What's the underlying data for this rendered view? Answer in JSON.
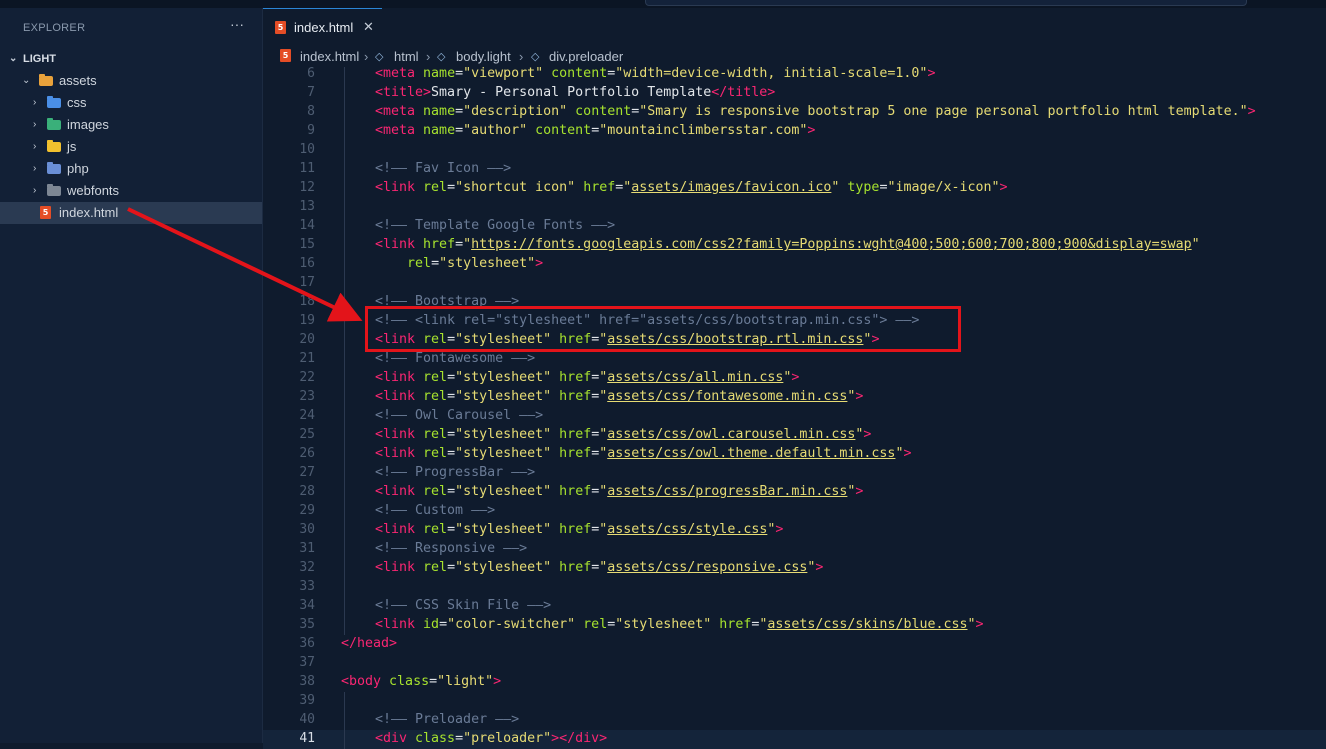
{
  "explorer": {
    "title": "EXPLORER",
    "more": "···",
    "root": "LIGHT",
    "items": [
      {
        "label": "assets",
        "kind": "folder-open",
        "icon": "folder-assets-icon"
      },
      {
        "label": "css",
        "kind": "folder",
        "icon": "folder-css-icon"
      },
      {
        "label": "images",
        "kind": "folder",
        "icon": "folder-images-icon"
      },
      {
        "label": "js",
        "kind": "folder",
        "icon": "folder-js-icon"
      },
      {
        "label": "php",
        "kind": "folder",
        "icon": "folder-php-icon"
      },
      {
        "label": "webfonts",
        "kind": "folder",
        "icon": "folder-webfonts-icon"
      },
      {
        "label": "index.html",
        "kind": "file",
        "icon": "html5-icon"
      }
    ]
  },
  "tab": {
    "label": "index.html",
    "close": "✕"
  },
  "breadcrumb": [
    "index.html",
    "html",
    "body.light",
    "div.preloader"
  ],
  "code": {
    "line_numbers": [
      "6",
      "7",
      "8",
      "9",
      "10",
      "11",
      "12",
      "13",
      "14",
      "15",
      "16",
      "17",
      "18",
      "19",
      "20",
      "21",
      "22",
      "23",
      "24",
      "25",
      "26",
      "27",
      "28",
      "29",
      "30",
      "31",
      "32",
      "33",
      "34",
      "35",
      "36",
      "37",
      "38",
      "39",
      "40",
      "41"
    ],
    "current_line": "41",
    "lines": [
      [
        [
          "t",
          "<meta "
        ],
        [
          "a",
          "name"
        ],
        [
          "p",
          "="
        ],
        [
          "s",
          "\"viewport\""
        ],
        [
          "a",
          " content"
        ],
        [
          "p",
          "="
        ],
        [
          "s",
          "\"width=device-width, initial-scale=1.0\""
        ],
        [
          "t",
          ">"
        ]
      ],
      [
        [
          "t",
          "<title>"
        ],
        [
          "p",
          "Smary - Personal Portfolio Template"
        ],
        [
          "t",
          "</title>"
        ]
      ],
      [
        [
          "t",
          "<meta "
        ],
        [
          "a",
          "name"
        ],
        [
          "p",
          "="
        ],
        [
          "s",
          "\"description\""
        ],
        [
          "a",
          " content"
        ],
        [
          "p",
          "="
        ],
        [
          "s",
          "\"Smary is responsive bootstrap 5 one page personal portfolio html template.\""
        ],
        [
          "t",
          ">"
        ]
      ],
      [
        [
          "t",
          "<meta "
        ],
        [
          "a",
          "name"
        ],
        [
          "p",
          "="
        ],
        [
          "s",
          "\"author\""
        ],
        [
          "a",
          " content"
        ],
        [
          "p",
          "="
        ],
        [
          "s",
          "\"mountainclimbersstar.com\""
        ],
        [
          "t",
          ">"
        ]
      ],
      [],
      [
        [
          "cm",
          "<!—— Fav Icon ——>"
        ]
      ],
      [
        [
          "t",
          "<link "
        ],
        [
          "a",
          "rel"
        ],
        [
          "p",
          "="
        ],
        [
          "s",
          "\"shortcut icon\""
        ],
        [
          "a",
          " href"
        ],
        [
          "p",
          "="
        ],
        [
          "s",
          "\""
        ],
        [
          "u",
          "assets/images/favicon.ico"
        ],
        [
          "s",
          "\""
        ],
        [
          "a",
          " type"
        ],
        [
          "p",
          "="
        ],
        [
          "s",
          "\"image/x-icon\""
        ],
        [
          "t",
          ">"
        ]
      ],
      [],
      [
        [
          "cm",
          "<!—— Template Google Fonts ——>"
        ]
      ],
      [
        [
          "t",
          "<link "
        ],
        [
          "a",
          "href"
        ],
        [
          "p",
          "="
        ],
        [
          "s",
          "\""
        ],
        [
          "u",
          "https://fonts.googleapis.com/css2?family=Poppins:wght@400;500;600;700;800;900&display=swap"
        ],
        [
          "s",
          "\""
        ]
      ],
      [
        [
          "p",
          "    "
        ],
        [
          "a",
          "rel"
        ],
        [
          "p",
          "="
        ],
        [
          "s",
          "\"stylesheet\""
        ],
        [
          "t",
          ">"
        ]
      ],
      [],
      [
        [
          "cm",
          "<!—— Bootstrap ——>"
        ]
      ],
      [
        [
          "cm",
          "<!—— <link rel=\"stylesheet\" href=\"assets/css/bootstrap.min.css\"> ——>"
        ]
      ],
      [
        [
          "t",
          "<link "
        ],
        [
          "a",
          "rel"
        ],
        [
          "p",
          "="
        ],
        [
          "s",
          "\"stylesheet\""
        ],
        [
          "a",
          " href"
        ],
        [
          "p",
          "="
        ],
        [
          "s",
          "\""
        ],
        [
          "u",
          "assets/css/bootstrap.rtl.min.css"
        ],
        [
          "s",
          "\""
        ],
        [
          "t",
          ">"
        ]
      ],
      [
        [
          "cm",
          "<!—— Fontawesome ——>"
        ]
      ],
      [
        [
          "t",
          "<link "
        ],
        [
          "a",
          "rel"
        ],
        [
          "p",
          "="
        ],
        [
          "s",
          "\"stylesheet\""
        ],
        [
          "a",
          " href"
        ],
        [
          "p",
          "="
        ],
        [
          "s",
          "\""
        ],
        [
          "u",
          "assets/css/all.min.css"
        ],
        [
          "s",
          "\""
        ],
        [
          "t",
          ">"
        ]
      ],
      [
        [
          "t",
          "<link "
        ],
        [
          "a",
          "rel"
        ],
        [
          "p",
          "="
        ],
        [
          "s",
          "\"stylesheet\""
        ],
        [
          "a",
          " href"
        ],
        [
          "p",
          "="
        ],
        [
          "s",
          "\""
        ],
        [
          "u",
          "assets/css/fontawesome.min.css"
        ],
        [
          "s",
          "\""
        ],
        [
          "t",
          ">"
        ]
      ],
      [
        [
          "cm",
          "<!—— Owl Carousel ——>"
        ]
      ],
      [
        [
          "t",
          "<link "
        ],
        [
          "a",
          "rel"
        ],
        [
          "p",
          "="
        ],
        [
          "s",
          "\"stylesheet\""
        ],
        [
          "a",
          " href"
        ],
        [
          "p",
          "="
        ],
        [
          "s",
          "\""
        ],
        [
          "u",
          "assets/css/owl.carousel.min.css"
        ],
        [
          "s",
          "\""
        ],
        [
          "t",
          ">"
        ]
      ],
      [
        [
          "t",
          "<link "
        ],
        [
          "a",
          "rel"
        ],
        [
          "p",
          "="
        ],
        [
          "s",
          "\"stylesheet\""
        ],
        [
          "a",
          " href"
        ],
        [
          "p",
          "="
        ],
        [
          "s",
          "\""
        ],
        [
          "u",
          "assets/css/owl.theme.default.min.css"
        ],
        [
          "s",
          "\""
        ],
        [
          "t",
          ">"
        ]
      ],
      [
        [
          "cm",
          "<!—— ProgressBar ——>"
        ]
      ],
      [
        [
          "t",
          "<link "
        ],
        [
          "a",
          "rel"
        ],
        [
          "p",
          "="
        ],
        [
          "s",
          "\"stylesheet\""
        ],
        [
          "a",
          " href"
        ],
        [
          "p",
          "="
        ],
        [
          "s",
          "\""
        ],
        [
          "u",
          "assets/css/progressBar.min.css"
        ],
        [
          "s",
          "\""
        ],
        [
          "t",
          ">"
        ]
      ],
      [
        [
          "cm",
          "<!—— Custom ——>"
        ]
      ],
      [
        [
          "t",
          "<link "
        ],
        [
          "a",
          "rel"
        ],
        [
          "p",
          "="
        ],
        [
          "s",
          "\"stylesheet\""
        ],
        [
          "a",
          " href"
        ],
        [
          "p",
          "="
        ],
        [
          "s",
          "\""
        ],
        [
          "u",
          "assets/css/style.css"
        ],
        [
          "s",
          "\""
        ],
        [
          "t",
          ">"
        ]
      ],
      [
        [
          "cm",
          "<!—— Responsive ——>"
        ]
      ],
      [
        [
          "t",
          "<link "
        ],
        [
          "a",
          "rel"
        ],
        [
          "p",
          "="
        ],
        [
          "s",
          "\"stylesheet\""
        ],
        [
          "a",
          " href"
        ],
        [
          "p",
          "="
        ],
        [
          "s",
          "\""
        ],
        [
          "u",
          "assets/css/responsive.css"
        ],
        [
          "s",
          "\""
        ],
        [
          "t",
          ">"
        ]
      ],
      [],
      [
        [
          "cm",
          "<!—— CSS Skin File ——>"
        ]
      ],
      [
        [
          "t",
          "<link "
        ],
        [
          "a",
          "id"
        ],
        [
          "p",
          "="
        ],
        [
          "s",
          "\"color-switcher\""
        ],
        [
          "a",
          " rel"
        ],
        [
          "p",
          "="
        ],
        [
          "s",
          "\"stylesheet\""
        ],
        [
          "a",
          " href"
        ],
        [
          "p",
          "="
        ],
        [
          "s",
          "\""
        ],
        [
          "u",
          "assets/css/skins/blue.css"
        ],
        [
          "s",
          "\""
        ],
        [
          "t",
          ">"
        ]
      ],
      [
        [
          "t",
          "</head>"
        ]
      ],
      [],
      [
        [
          "t",
          "<body "
        ],
        [
          "a",
          "class"
        ],
        [
          "p",
          "="
        ],
        [
          "s",
          "\"light\""
        ],
        [
          "t",
          ">"
        ]
      ],
      [],
      [
        [
          "cm",
          "<!—— Preloader ——>"
        ]
      ],
      [
        [
          "t",
          "<div "
        ],
        [
          "a",
          "class"
        ],
        [
          "p",
          "="
        ],
        [
          "s",
          "\"preloader\""
        ],
        [
          "t",
          "></div>"
        ]
      ]
    ]
  },
  "colors": {
    "highlight": "#e3141a",
    "accent": "#2b86d6"
  }
}
